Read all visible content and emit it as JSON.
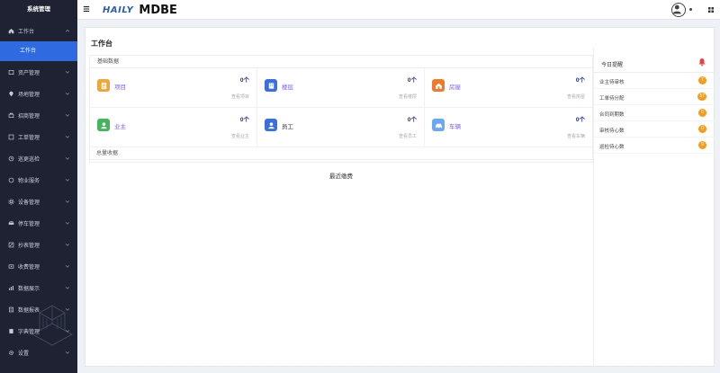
{
  "sidebar": {
    "title": "系统管理",
    "items": [
      {
        "label": "工作台",
        "icon": "home-icon",
        "expanded": true
      },
      {
        "label": "资产管理",
        "icon": "asset-icon"
      },
      {
        "label": "场地管理",
        "icon": "location-icon"
      },
      {
        "label": "招商管理",
        "icon": "briefcase-icon"
      },
      {
        "label": "工单管理",
        "icon": "ticket-icon"
      },
      {
        "label": "巡更巡检",
        "icon": "clock-icon"
      },
      {
        "label": "物业服务",
        "icon": "service-icon"
      },
      {
        "label": "设备管理",
        "icon": "device-icon"
      },
      {
        "label": "停车管理",
        "icon": "car-icon"
      },
      {
        "label": "抄表管理",
        "icon": "meter-icon"
      },
      {
        "label": "收费管理",
        "icon": "money-icon"
      },
      {
        "label": "数据展示",
        "icon": "chart-icon"
      },
      {
        "label": "数据报表",
        "icon": "report-icon"
      },
      {
        "label": "字典管理",
        "icon": "dictionary-icon"
      },
      {
        "label": "设置",
        "icon": "gear-icon"
      }
    ],
    "active_sub": "工作台"
  },
  "header": {
    "logo_mark": "HAILY",
    "logo_text": "MDBE"
  },
  "main": {
    "title": "工作台",
    "basic": {
      "heading": "基础数据",
      "stats": [
        {
          "name": "项目",
          "value": "0个",
          "more": "查看项目",
          "color": "#f0a53c",
          "icon": "document-icon",
          "link": true
        },
        {
          "name": "楼层",
          "value": "0个",
          "more": "查看楼层",
          "color": "#3b6fe0",
          "icon": "building-icon",
          "link": true
        },
        {
          "name": "房屋",
          "value": "0个",
          "more": "查看房屋",
          "color": "#f07a2c",
          "icon": "house-icon",
          "link": true
        },
        {
          "name": "业主",
          "value": "0个",
          "more": "查看业主",
          "color": "#45b45d",
          "icon": "user-icon",
          "link": true
        },
        {
          "name": "员工",
          "value": "0个",
          "more": "查看员工",
          "color": "#3b6fe0",
          "icon": "staff-icon",
          "link": false
        },
        {
          "name": "车辆",
          "value": "0个",
          "more": "查看车辆",
          "color": "#6aa9f2",
          "icon": "car-icon",
          "link": true
        }
      ]
    },
    "receipts": {
      "heading": "总量收据",
      "subtitle": "最近缴费"
    }
  },
  "reminder": {
    "title": "今日提醒",
    "items": [
      {
        "label": "业主待审核",
        "count": "7"
      },
      {
        "label": "工单待分配",
        "count": "57"
      },
      {
        "label": "合同到期数",
        "count": "0"
      },
      {
        "label": "审核待心数",
        "count": "0"
      },
      {
        "label": "巡检待心数",
        "count": "9"
      }
    ]
  },
  "colors": {
    "sidebar_bg": "#1f2233",
    "active": "#2f6ae0",
    "badge": "#f39c1f",
    "bell": "#e8403c"
  }
}
